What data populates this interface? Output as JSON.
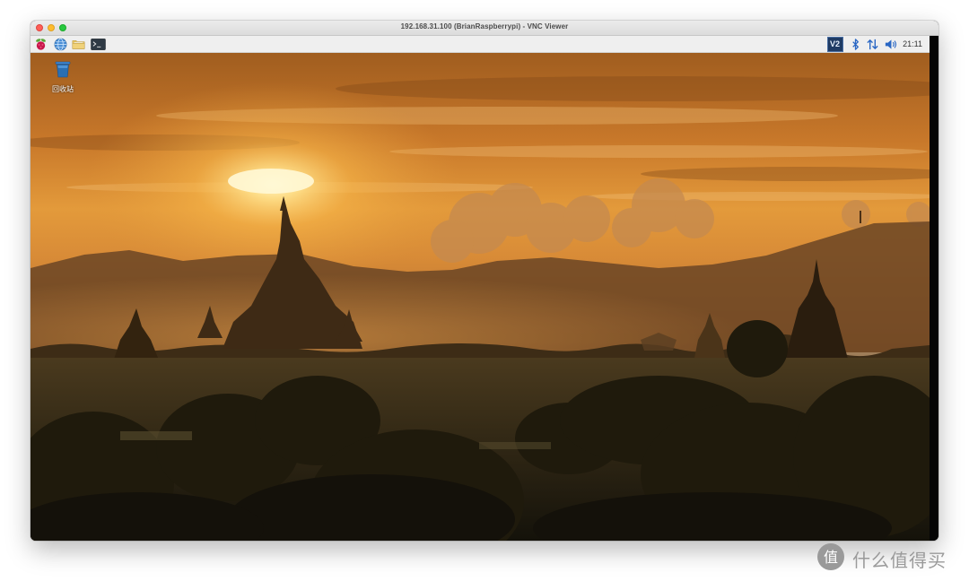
{
  "window": {
    "title": "192.168.31.100 (BrianRaspberrypi) - VNC Viewer"
  },
  "taskbar": {
    "launchers": [
      {
        "icon": "raspberry-menu-icon"
      },
      {
        "icon": "web-browser-icon"
      },
      {
        "icon": "file-manager-icon"
      },
      {
        "icon": "terminal-icon"
      }
    ],
    "tray": [
      {
        "icon": "vnc-server-icon",
        "label": "V2"
      },
      {
        "icon": "bluetooth-icon"
      },
      {
        "icon": "network-icon"
      },
      {
        "icon": "volume-icon"
      }
    ],
    "clock": "21:11"
  },
  "desktop": {
    "icons": [
      {
        "icon": "trash-icon",
        "label": "回收站"
      }
    ],
    "wallpaper": "sunset-pagodas"
  },
  "watermark": {
    "logo_text": "值",
    "text": "什么值得买"
  },
  "colors": {
    "taskbar_bg": "#efefef",
    "vnc_blue": "#1f3b64",
    "trash_blue": "#2a6fb3",
    "sky_top": "#b86a1c",
    "sun_glow": "#ffe8a0"
  }
}
